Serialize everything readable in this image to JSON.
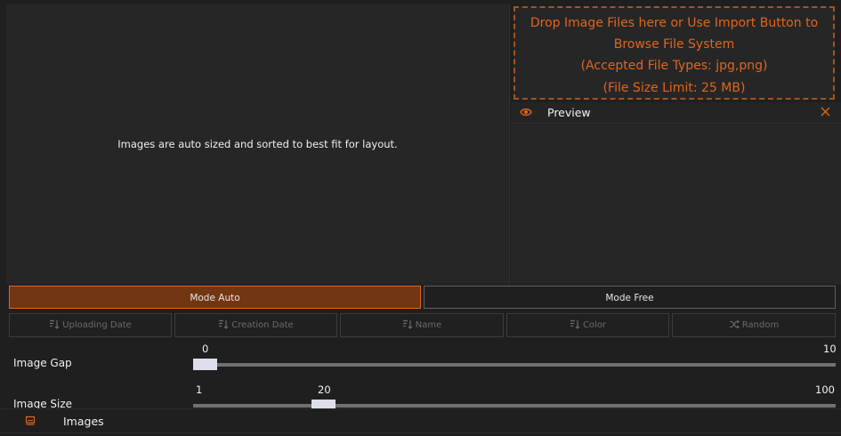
{
  "canvas": {
    "message": "Images are auto sized and sorted to best fit for layout."
  },
  "drop_zone": {
    "line1": "Drop Image Files here or Use Import Button to",
    "line2": "Browse File System",
    "line3": "(Accepted File Types: jpg,png)",
    "line4": "(File Size Limit: 25 MB)"
  },
  "preview": {
    "title": "Preview",
    "icon": "eye-icon",
    "close_icon": "close-icon"
  },
  "modes": {
    "auto_label": "Mode Auto",
    "free_label": "Mode Free",
    "active": "auto"
  },
  "sort_buttons": [
    {
      "label": "Uploading Date",
      "icon": "sort-icon"
    },
    {
      "label": "Creation Date",
      "icon": "sort-icon"
    },
    {
      "label": "Name",
      "icon": "sort-icon"
    },
    {
      "label": "Color",
      "icon": "sort-icon"
    },
    {
      "label": "Random",
      "icon": "shuffle-icon"
    }
  ],
  "sliders": {
    "gap": {
      "label": "Image Gap",
      "min": "0",
      "max": "10",
      "value": 0
    },
    "size": {
      "label": "Image Size",
      "min": "1",
      "max": "100",
      "value": 20,
      "value_label": "20"
    }
  },
  "footer": {
    "label": "Images",
    "icon": "images-icon"
  },
  "colors": {
    "accent": "#e0661e",
    "accent_dark": "#733612",
    "background": "#1f1f1f",
    "panel": "#262626"
  }
}
